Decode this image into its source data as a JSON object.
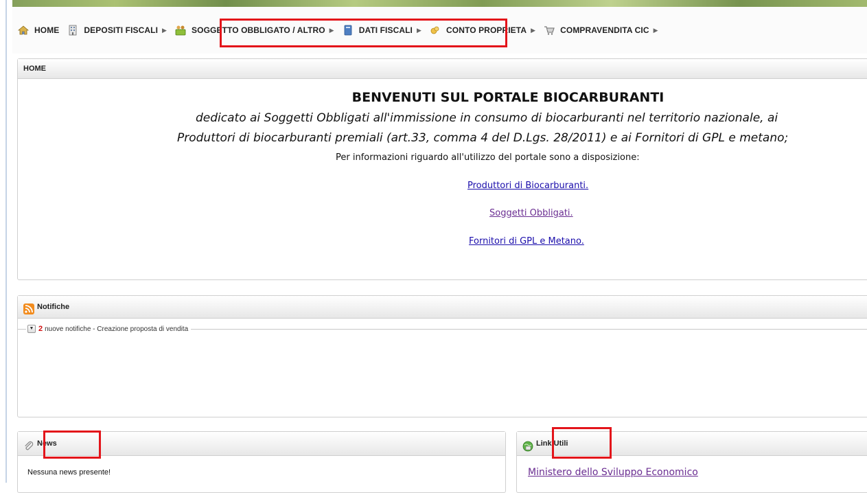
{
  "nav": {
    "items": [
      {
        "label": "HOME",
        "icon": "home-icon"
      },
      {
        "label": "DEPOSITI FISCALI",
        "icon": "building-icon"
      },
      {
        "label": "SOGGETTO OBBLIGATO / ALTRO",
        "icon": "people-icon"
      },
      {
        "label": "DATI FISCALI",
        "icon": "book-icon"
      },
      {
        "label": "CONTO PROPRIETA",
        "icon": "coins-icon"
      },
      {
        "label": "COMPRAVENDITA CIC",
        "icon": "cart-icon"
      }
    ]
  },
  "home_panel": {
    "title": "HOME",
    "welcome_title": "BENVENUTI SUL PORTALE BIOCARBURANTI",
    "subtitle_line1": "dedicato ai Soggetti Obbligati all'immissione in consumo di biocarburanti nel territorio nazionale, ai",
    "subtitle_line2": "Produttori di biocarburanti premiali (art.33, comma 4 del D.Lgs. 28/2011) e ai Fornitori di GPL e metano;",
    "info_text": "Per informazioni riguardo all'utilizzo del portale sono a disposizione:",
    "links": [
      "Produttori di Biocarburanti.",
      "Soggetti Obbligati.",
      "Fornitori di GPL e Metano."
    ]
  },
  "notifications_panel": {
    "title": "Notifiche",
    "count": "2",
    "summary_text": "nuove notifiche - Creazione proposta di vendita"
  },
  "news_panel": {
    "title": "News",
    "empty_text": "Nessuna news presente!"
  },
  "links_panel": {
    "title": "Link Utili",
    "first_link": "Ministero dello Sviluppo Economico"
  },
  "colors": {
    "highlight": "#e3141a",
    "link": "#1a0dab",
    "visited_link": "#6a2d91",
    "notification_count": "#d01010"
  }
}
